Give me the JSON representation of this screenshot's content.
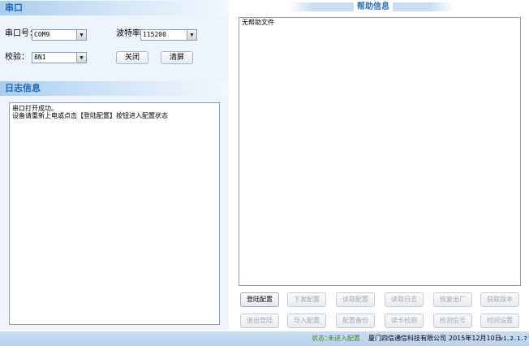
{
  "serial": {
    "header": "串口",
    "port_label": "串口号：",
    "port_value": "COM9",
    "baud_label": "波特率：",
    "baud_value": "115200",
    "parity_label": "校验：",
    "parity_value": "8N1",
    "close_button": "关闭",
    "clear_button": "清屏"
  },
  "log": {
    "header": "日志信息",
    "text": "串口打开成功。\n设备请重新上电或点击【登陆配置】按钮进入配置状态"
  },
  "help": {
    "title": "帮助信息",
    "text": "无帮助文件"
  },
  "actions": {
    "row1": [
      "登陆配置",
      "下发配置",
      "读取配置",
      "读取日志",
      "恢复出厂",
      "获取版本"
    ],
    "row2": [
      "退出登陆",
      "导入配置",
      "配置备份",
      "读卡检测",
      "检测信号",
      "时间设置"
    ]
  },
  "status": {
    "label": "状态：",
    "value": "未进入配置",
    "company": "厦门四信通信科技有限公司",
    "date": "2015年12月10日",
    "version": "v1.2.1.7"
  }
}
